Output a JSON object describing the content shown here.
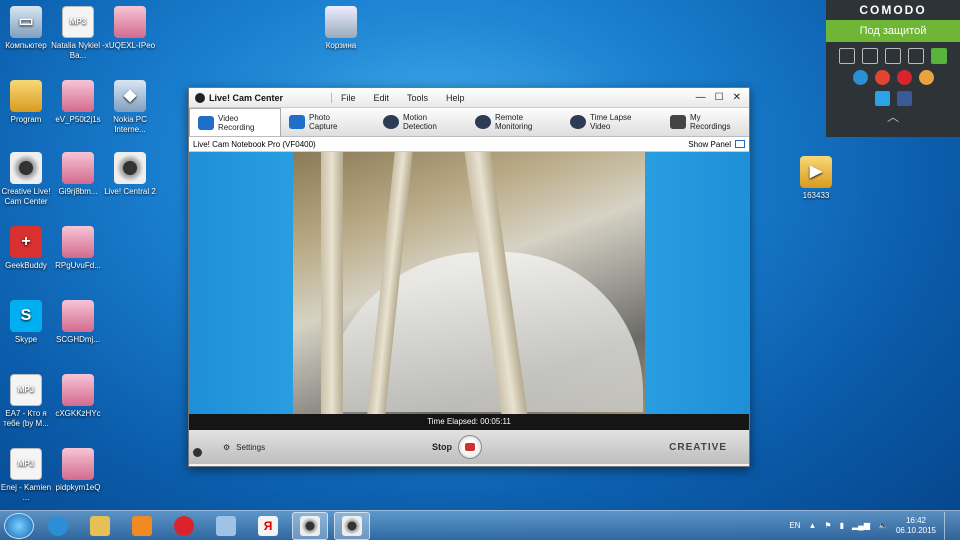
{
  "desktop": {
    "icons": [
      {
        "label": "Компьютер",
        "glyph": "computer-icon"
      },
      {
        "label": "Natalia Nykiel - Ba...",
        "glyph": "mp3-icon"
      },
      {
        "label": "xUQEXL-IPeo",
        "glyph": "photo-icon"
      },
      {
        "label": "Корзина",
        "glyph": "trash-icon"
      },
      {
        "label": "Program",
        "glyph": "folder-icon"
      },
      {
        "label": "eV_P50t2j1s",
        "glyph": "photo-icon"
      },
      {
        "label": "Nokia PC Interne...",
        "glyph": "nokia-icon"
      },
      {
        "label": "Creative Live! Cam Center",
        "glyph": "webcam-icon"
      },
      {
        "label": "Gi9rj8bm...",
        "glyph": "photo-icon"
      },
      {
        "label": "Live! Central 2",
        "glyph": "webcam-icon"
      },
      {
        "label": "GeekBuddy",
        "glyph": "geekbuddy-icon"
      },
      {
        "label": "RPgUvuFd...",
        "glyph": "photo-icon"
      },
      {
        "label": "Skype",
        "glyph": "skype-icon"
      },
      {
        "label": "SCGHDmj...",
        "glyph": "photo-icon"
      },
      {
        "label": "EA7 - Кто я тебе (by M...",
        "glyph": "mp3-icon"
      },
      {
        "label": "cXGKKzHYc",
        "glyph": "photo-icon"
      },
      {
        "label": "Enej - Kamien ...",
        "glyph": "mp3-icon"
      },
      {
        "label": "pidpkym1eQ",
        "glyph": "photo-icon"
      },
      {
        "label": "163433",
        "glyph": "video-icon"
      }
    ],
    "mp3_badge": "MP3"
  },
  "comodo": {
    "brand": "COMODO",
    "status": "Под защитой"
  },
  "app": {
    "title": "Live! Cam Center",
    "menu": [
      "File",
      "Edit",
      "Tools",
      "Help"
    ],
    "modes": [
      {
        "line1": "Video",
        "line2": "Recording"
      },
      {
        "line1": "Photo",
        "line2": "Capture"
      },
      {
        "line1": "Motion",
        "line2": "Detection"
      },
      {
        "line1": "Remote",
        "line2": "Monitoring"
      },
      {
        "line1": "Time Lapse",
        "line2": "Video"
      },
      {
        "line1": "My",
        "line2": "Recordings"
      }
    ],
    "device": "Live! Cam Notebook Pro (VF0400)",
    "show_panel": "Show Panel",
    "elapsed": "Time Elapsed: 00:05:11",
    "settings_label": "Settings",
    "stop_label": "Stop",
    "brand": "CREATIVE"
  },
  "taskbar": {
    "lang": "EN",
    "time": "16:42",
    "date": "06.10.2015"
  }
}
